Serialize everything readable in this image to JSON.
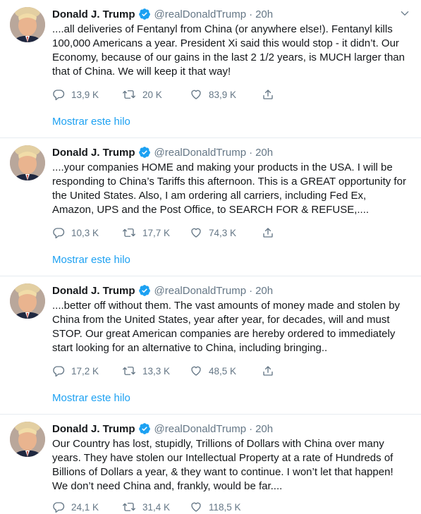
{
  "colors": {
    "accent": "#1da1f2",
    "muted": "#657786",
    "text": "#14171a",
    "border": "#e6ecf0"
  },
  "icons": {
    "reply": "comment-bubble-icon",
    "retweet": "retweet-icon",
    "like": "heart-icon",
    "share": "share-upload-icon",
    "verified": "verified-badge-icon",
    "menu": "chevron-down-icon"
  },
  "tweets": [
    {
      "name": "Donald J. Trump",
      "handle": "@realDonaldTrump",
      "separator": "·",
      "time": "20h",
      "text": "....all deliveries of Fentanyl from China (or anywhere else!). Fentanyl kills 100,000 Americans a year. President Xi said this would stop - it didn’t. Our Economy, because of our gains in the last 2 1/2 years, is MUCH larger than that of China. We will keep it that way!",
      "replies": "13,9 K",
      "retweets": "20 K",
      "likes": "83,9 K",
      "thread_link": "Mostrar este hilo"
    },
    {
      "name": "Donald J. Trump",
      "handle": "@realDonaldTrump",
      "separator": "·",
      "time": "20h",
      "text": "....your companies HOME and making your products in the USA. I will be responding to China’s Tariffs this afternoon. This is a GREAT opportunity for the United States. Also, I am ordering all carriers, including Fed Ex, Amazon, UPS and the Post Office, to SEARCH FOR & REFUSE,....",
      "replies": "10,3 K",
      "retweets": "17,7 K",
      "likes": "74,3 K",
      "thread_link": "Mostrar este hilo"
    },
    {
      "name": "Donald J. Trump",
      "handle": "@realDonaldTrump",
      "separator": "·",
      "time": "20h",
      "text": "....better off without them. The vast amounts of money made and stolen by China from the United States, year after year, for decades, will and must STOP. Our great American companies are hereby ordered to immediately start looking for an alternative to China, including bringing..",
      "replies": "17,2 K",
      "retweets": "13,3 K",
      "likes": "48,5 K",
      "thread_link": "Mostrar este hilo"
    },
    {
      "name": "Donald J. Trump",
      "handle": "@realDonaldTrump",
      "separator": "·",
      "time": "20h",
      "text": "Our Country has lost, stupidly, Trillions of Dollars with China over many years. They have stolen our Intellectual Property at a rate of Hundreds of Billions of Dollars a year, & they want to continue. I won’t let that happen! We don’t need China and, frankly, would be far....",
      "replies": "24,1 K",
      "retweets": "31,4 K",
      "likes": "118,5 K"
    }
  ]
}
